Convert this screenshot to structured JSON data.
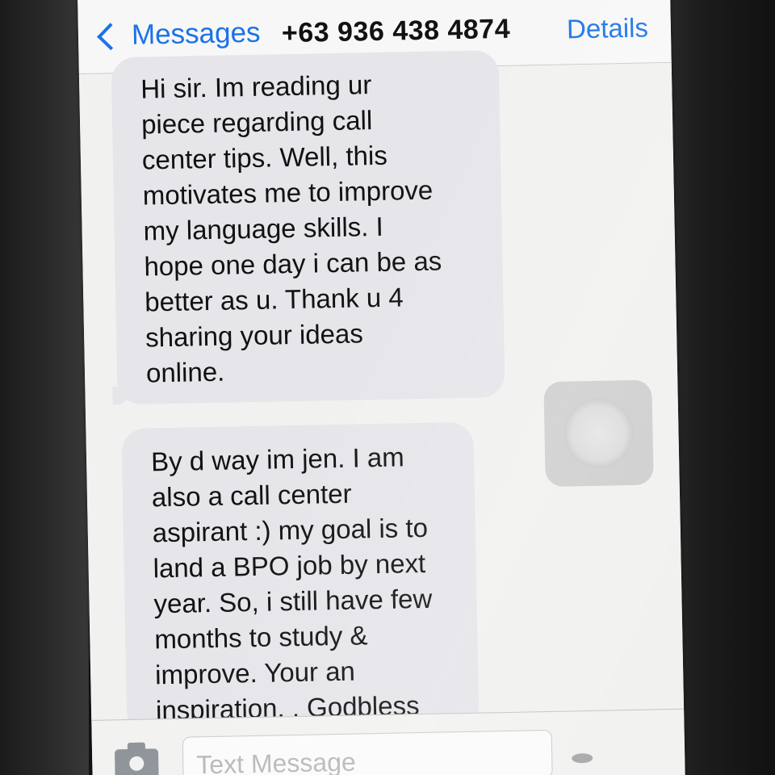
{
  "navbar": {
    "back_label": "Messages",
    "title": "+63 936 438 4874",
    "details_label": "Details"
  },
  "messages": [
    {
      "lines": [
        "Hi sir. Im reading ur",
        "piece regarding call",
        "center tips. Well, this",
        "motivates me to improve",
        "my language skills. I",
        "hope one day i can be as",
        "better as u. Thank u 4",
        "sharing your ideas",
        "online."
      ]
    },
    {
      "lines": [
        "By d way im jen. I am",
        "also a call center",
        "aspirant :) my goal is to",
        "land a BPO job by next",
        "year. So, i still have few",
        "months to study &",
        "improve. Your an",
        "inspiration. . Godbless"
      ]
    }
  ],
  "composer": {
    "placeholder": "Text Message"
  },
  "icons": {
    "back": "chevron-left-icon",
    "camera": "camera-icon"
  },
  "colors": {
    "accent": "#1a73e8",
    "incoming_bubble": "#e5e5ea"
  }
}
